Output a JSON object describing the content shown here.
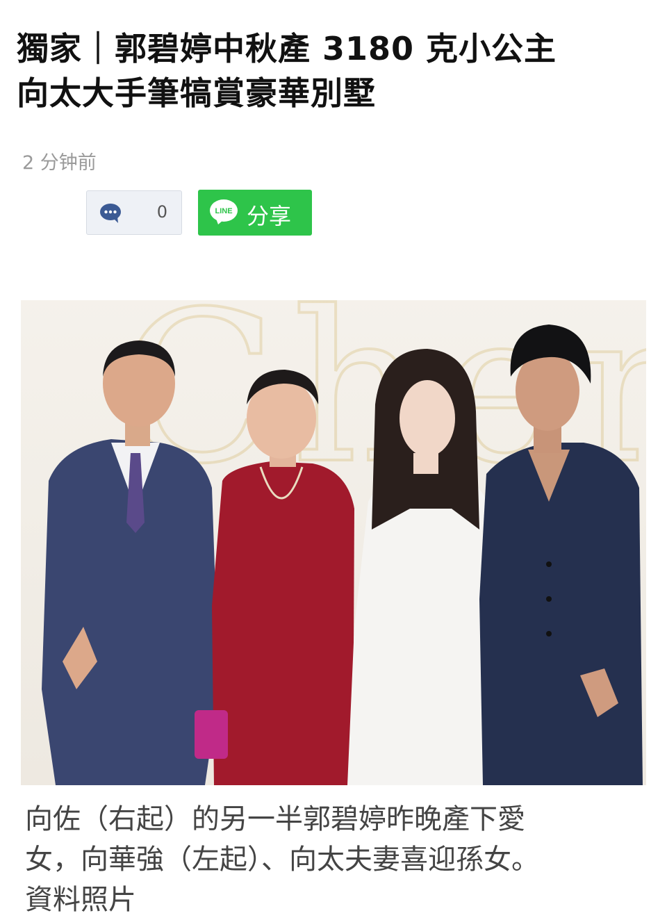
{
  "article": {
    "headline_line1": "獨家｜郭碧婷中秋產 3180 克小公主",
    "headline_line2": "向太大手筆犒賞豪華別墅",
    "timestamp": "2 分钟前"
  },
  "actions": {
    "comment_icon": "speech-bubble-icon",
    "comment_count": "0",
    "share_logo_text": "LINE",
    "share_label": "分享",
    "share_color": "#2ec44a"
  },
  "photo": {
    "background_text": "Chen"
  },
  "caption": {
    "line1": "向佐（右起）的另一半郭碧婷昨晚產下愛",
    "line2": "女，向華強（左起）、向太夫妻喜迎孫女。",
    "line3": "資料照片"
  }
}
